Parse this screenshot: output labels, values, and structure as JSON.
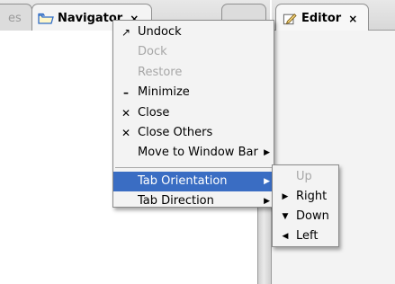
{
  "tabs": {
    "left": [
      {
        "label": "es",
        "icon": "none"
      },
      {
        "label": "Navigator",
        "icon": "folder-icon",
        "close": "×"
      }
    ],
    "right": [
      {
        "label": "Editor",
        "icon": "edit-icon",
        "close": "×"
      }
    ]
  },
  "context_menu": {
    "items": [
      {
        "label": "Undock",
        "icon": "undock-arrow-icon",
        "lead": "↗",
        "enabled": true
      },
      {
        "label": "Dock",
        "enabled": false
      },
      {
        "label": "Restore",
        "enabled": false
      },
      {
        "label": "Minimize",
        "icon": "minimize-icon",
        "lead": "–",
        "enabled": true
      },
      {
        "label": "Close",
        "icon": "close-icon",
        "lead": "✕",
        "enabled": true
      },
      {
        "label": "Close Others",
        "icon": "close-others-icon",
        "lead": "✕",
        "enabled": true
      },
      {
        "label": "Move to Window Bar",
        "submenu_arrow": "▶",
        "enabled": true
      },
      {
        "label": "Tab Orientation",
        "submenu_arrow": "▶",
        "selected": true,
        "enabled": true
      },
      {
        "label": "Tab Direction",
        "submenu_arrow": "▶",
        "enabled": true
      }
    ]
  },
  "submenu": {
    "items": [
      {
        "label": "Up",
        "enabled": false
      },
      {
        "label": "Right",
        "icon": "arrow-right-icon",
        "lead": "▶",
        "enabled": true
      },
      {
        "label": "Down",
        "icon": "arrow-down-icon",
        "lead": "▼",
        "enabled": true
      },
      {
        "label": "Left",
        "icon": "arrow-left-icon",
        "lead": "◀",
        "enabled": true
      }
    ]
  },
  "colors": {
    "selection": "#3a6dc3",
    "menu_bg": "#f3f3f3",
    "disabled_text": "#a7a7a7"
  }
}
